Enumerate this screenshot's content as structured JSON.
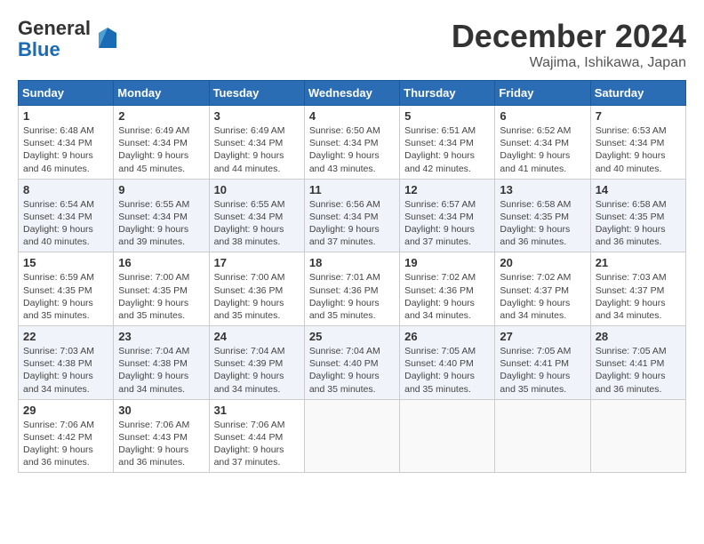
{
  "header": {
    "logo_line1": "General",
    "logo_line2": "Blue",
    "title": "December 2024",
    "subtitle": "Wajima, Ishikawa, Japan"
  },
  "columns": [
    "Sunday",
    "Monday",
    "Tuesday",
    "Wednesday",
    "Thursday",
    "Friday",
    "Saturday"
  ],
  "weeks": [
    [
      {
        "day": "1",
        "sunrise": "6:48 AM",
        "sunset": "4:34 PM",
        "daylight": "9 hours and 46 minutes."
      },
      {
        "day": "2",
        "sunrise": "6:49 AM",
        "sunset": "4:34 PM",
        "daylight": "9 hours and 45 minutes."
      },
      {
        "day": "3",
        "sunrise": "6:49 AM",
        "sunset": "4:34 PM",
        "daylight": "9 hours and 44 minutes."
      },
      {
        "day": "4",
        "sunrise": "6:50 AM",
        "sunset": "4:34 PM",
        "daylight": "9 hours and 43 minutes."
      },
      {
        "day": "5",
        "sunrise": "6:51 AM",
        "sunset": "4:34 PM",
        "daylight": "9 hours and 42 minutes."
      },
      {
        "day": "6",
        "sunrise": "6:52 AM",
        "sunset": "4:34 PM",
        "daylight": "9 hours and 41 minutes."
      },
      {
        "day": "7",
        "sunrise": "6:53 AM",
        "sunset": "4:34 PM",
        "daylight": "9 hours and 40 minutes."
      }
    ],
    [
      {
        "day": "8",
        "sunrise": "6:54 AM",
        "sunset": "4:34 PM",
        "daylight": "9 hours and 40 minutes."
      },
      {
        "day": "9",
        "sunrise": "6:55 AM",
        "sunset": "4:34 PM",
        "daylight": "9 hours and 39 minutes."
      },
      {
        "day": "10",
        "sunrise": "6:55 AM",
        "sunset": "4:34 PM",
        "daylight": "9 hours and 38 minutes."
      },
      {
        "day": "11",
        "sunrise": "6:56 AM",
        "sunset": "4:34 PM",
        "daylight": "9 hours and 37 minutes."
      },
      {
        "day": "12",
        "sunrise": "6:57 AM",
        "sunset": "4:34 PM",
        "daylight": "9 hours and 37 minutes."
      },
      {
        "day": "13",
        "sunrise": "6:58 AM",
        "sunset": "4:35 PM",
        "daylight": "9 hours and 36 minutes."
      },
      {
        "day": "14",
        "sunrise": "6:58 AM",
        "sunset": "4:35 PM",
        "daylight": "9 hours and 36 minutes."
      }
    ],
    [
      {
        "day": "15",
        "sunrise": "6:59 AM",
        "sunset": "4:35 PM",
        "daylight": "9 hours and 35 minutes."
      },
      {
        "day": "16",
        "sunrise": "7:00 AM",
        "sunset": "4:35 PM",
        "daylight": "9 hours and 35 minutes."
      },
      {
        "day": "17",
        "sunrise": "7:00 AM",
        "sunset": "4:36 PM",
        "daylight": "9 hours and 35 minutes."
      },
      {
        "day": "18",
        "sunrise": "7:01 AM",
        "sunset": "4:36 PM",
        "daylight": "9 hours and 35 minutes."
      },
      {
        "day": "19",
        "sunrise": "7:02 AM",
        "sunset": "4:36 PM",
        "daylight": "9 hours and 34 minutes."
      },
      {
        "day": "20",
        "sunrise": "7:02 AM",
        "sunset": "4:37 PM",
        "daylight": "9 hours and 34 minutes."
      },
      {
        "day": "21",
        "sunrise": "7:03 AM",
        "sunset": "4:37 PM",
        "daylight": "9 hours and 34 minutes."
      }
    ],
    [
      {
        "day": "22",
        "sunrise": "7:03 AM",
        "sunset": "4:38 PM",
        "daylight": "9 hours and 34 minutes."
      },
      {
        "day": "23",
        "sunrise": "7:04 AM",
        "sunset": "4:38 PM",
        "daylight": "9 hours and 34 minutes."
      },
      {
        "day": "24",
        "sunrise": "7:04 AM",
        "sunset": "4:39 PM",
        "daylight": "9 hours and 34 minutes."
      },
      {
        "day": "25",
        "sunrise": "7:04 AM",
        "sunset": "4:40 PM",
        "daylight": "9 hours and 35 minutes."
      },
      {
        "day": "26",
        "sunrise": "7:05 AM",
        "sunset": "4:40 PM",
        "daylight": "9 hours and 35 minutes."
      },
      {
        "day": "27",
        "sunrise": "7:05 AM",
        "sunset": "4:41 PM",
        "daylight": "9 hours and 35 minutes."
      },
      {
        "day": "28",
        "sunrise": "7:05 AM",
        "sunset": "4:41 PM",
        "daylight": "9 hours and 36 minutes."
      }
    ],
    [
      {
        "day": "29",
        "sunrise": "7:06 AM",
        "sunset": "4:42 PM",
        "daylight": "9 hours and 36 minutes."
      },
      {
        "day": "30",
        "sunrise": "7:06 AM",
        "sunset": "4:43 PM",
        "daylight": "9 hours and 36 minutes."
      },
      {
        "day": "31",
        "sunrise": "7:06 AM",
        "sunset": "4:44 PM",
        "daylight": "9 hours and 37 minutes."
      },
      null,
      null,
      null,
      null
    ]
  ],
  "labels": {
    "sunrise": "Sunrise:",
    "sunset": "Sunset:",
    "daylight": "Daylight:"
  }
}
